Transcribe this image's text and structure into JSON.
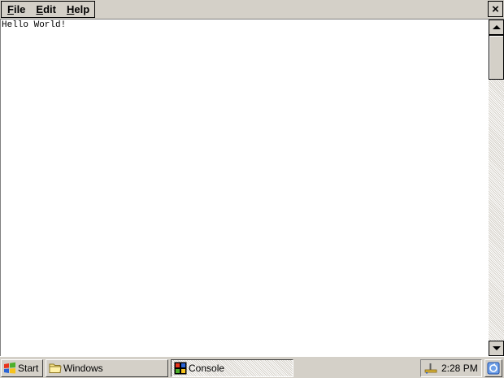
{
  "menubar": {
    "items": [
      {
        "label": "File",
        "mnemonic": "F",
        "rest": "ile"
      },
      {
        "label": "Edit",
        "mnemonic": "E",
        "rest": "dit"
      },
      {
        "label": "Help",
        "mnemonic": "H",
        "rest": "elp"
      }
    ],
    "close_glyph": "×"
  },
  "console": {
    "text": "Hello World!"
  },
  "taskbar": {
    "start_label": "Start",
    "windows_label": "Windows",
    "console_label": "Console",
    "clock": "2:28 PM"
  },
  "icons": {
    "start": "windows-flag-icon",
    "windows": "folder-icon",
    "console": "console-app-icon",
    "tray": "network-icon",
    "desktop": "show-desktop-icon"
  },
  "colors": {
    "chrome": "#d4d0c8",
    "console_bg": "#ffffff",
    "text": "#000000"
  }
}
